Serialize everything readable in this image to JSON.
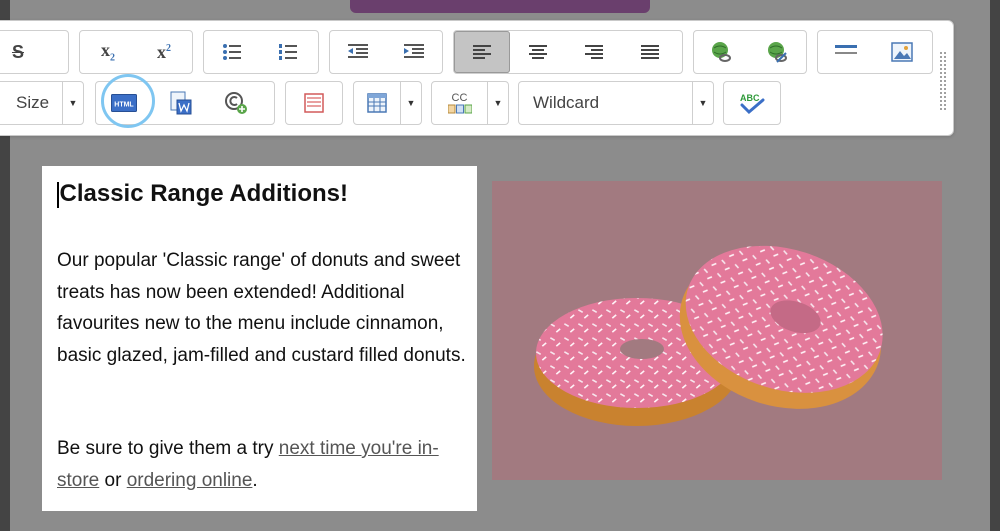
{
  "toolbar": {
    "row1": {
      "formatting": [
        {
          "name": "strikethrough-icon",
          "glyph": "S"
        },
        {
          "name": "subscript-icon",
          "glyph": "x",
          "sub": "2"
        },
        {
          "name": "superscript-icon",
          "glyph": "x",
          "sup": "2"
        }
      ]
    },
    "row2": {
      "size_label": "Size",
      "wildcard_label": "Wildcard",
      "cc_label": "CC",
      "html_label": "HTML",
      "spellcheck_label": "ABC"
    }
  },
  "article": {
    "heading": "Classic Range Additions!",
    "paragraph1": "Our popular 'Classic range' of donuts and sweet treats has now been extended! Additional favourites new to the menu include cinnamon, basic glazed, jam-filled and custard filled donuts.",
    "paragraph2_prefix": "Be sure to give them a try ",
    "link1": "next time you're in-store",
    "paragraph2_middle": " or ",
    "link2": "ordering online",
    "paragraph2_suffix": "."
  },
  "colors": {
    "accent_ring": "#7fc6f1",
    "image_tint": "#a27a80",
    "donut_glaze": "#e3799a",
    "donut_dough": "#d9913f"
  }
}
